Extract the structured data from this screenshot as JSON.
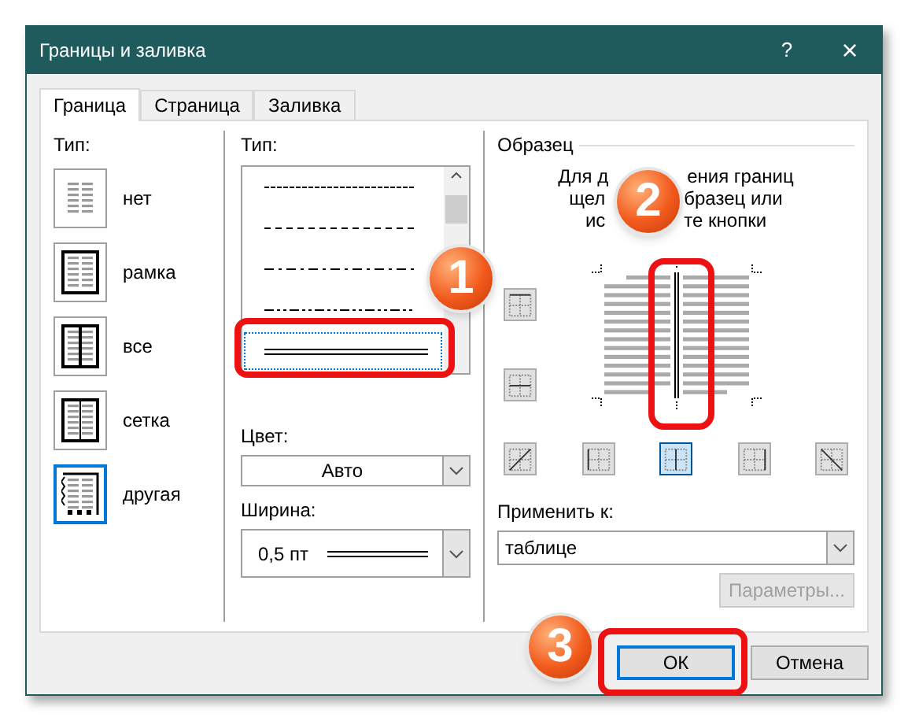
{
  "window": {
    "title": "Границы и заливка",
    "help": "?",
    "close": "×"
  },
  "tabs": [
    {
      "label": "Граница",
      "selected": true
    },
    {
      "label": "Страница",
      "selected": false
    },
    {
      "label": "Заливка",
      "selected": false
    }
  ],
  "setting": {
    "label": "Тип:",
    "items": [
      {
        "label": "нет",
        "kind": "none",
        "selected": false
      },
      {
        "label": "рамка",
        "kind": "box",
        "selected": false
      },
      {
        "label": "все",
        "kind": "all",
        "selected": false
      },
      {
        "label": "сетка",
        "kind": "grid",
        "selected": false
      },
      {
        "label": "другая",
        "kind": "custom",
        "selected": true
      }
    ]
  },
  "style": {
    "label": "Тип:",
    "items": [
      {
        "kind": "dotted",
        "selected": false
      },
      {
        "kind": "dashed",
        "selected": false
      },
      {
        "kind": "dashdot",
        "selected": false
      },
      {
        "kind": "dashdotdot",
        "selected": false
      },
      {
        "kind": "double",
        "selected": true
      }
    ]
  },
  "color": {
    "label": "Цвет:",
    "value": "Авто"
  },
  "width": {
    "label": "Ширина:",
    "value": "0,5 пт"
  },
  "preview": {
    "label": "Образец",
    "hint_lines": [
      [
        "Для д",
        "ения границ"
      ],
      [
        "щел",
        "бразец или"
      ],
      [
        "ис",
        "те кнопки"
      ]
    ],
    "side_buttons": [
      {
        "kind": "top",
        "selected": false
      },
      {
        "kind": "middle",
        "selected": false
      }
    ],
    "bottom_buttons": [
      {
        "kind": "diag-up",
        "selected": false
      },
      {
        "kind": "left",
        "selected": false
      },
      {
        "kind": "center",
        "selected": true
      },
      {
        "kind": "right",
        "selected": false
      },
      {
        "kind": "diag-down",
        "selected": false
      }
    ]
  },
  "apply": {
    "label": "Применить к:",
    "value": "таблице"
  },
  "options_button": {
    "label": "Параметры...",
    "disabled": true
  },
  "buttons": [
    {
      "label": "ОК",
      "kind": "primary"
    },
    {
      "label": "Отмена",
      "kind": "normal"
    }
  ],
  "callouts": [
    {
      "number": "1"
    },
    {
      "number": "2"
    },
    {
      "number": "3"
    }
  ]
}
